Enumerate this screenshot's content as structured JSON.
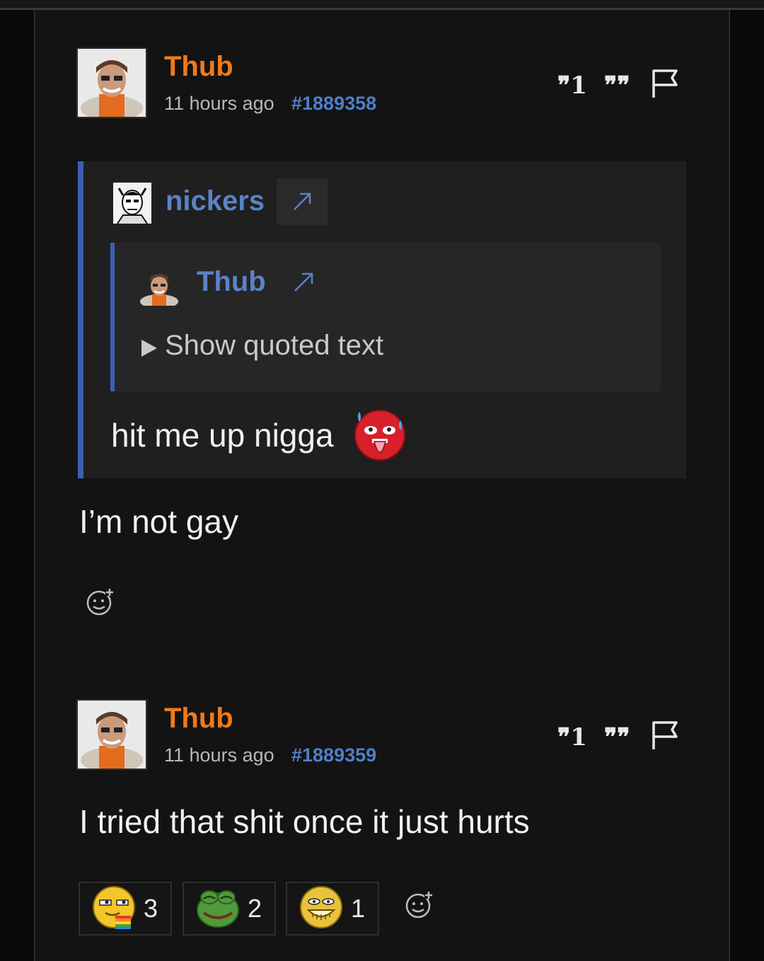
{
  "posts": [
    {
      "username": "Thub",
      "time": "11 hours ago",
      "post_id": "#1889358",
      "quote": {
        "author": "nickers",
        "nested_author": "Thub",
        "show_quoted_label": "Show quoted text",
        "text": "hit me up nigga"
      },
      "body": "I’m not gay"
    },
    {
      "username": "Thub",
      "time": "11 hours ago",
      "post_id": "#1889359",
      "body": "I tried that shit once it just hurts",
      "reactions": [
        {
          "icon": "gay-face-emoji-icon",
          "count": "3"
        },
        {
          "icon": "pepe-frog-emoji-icon",
          "count": "2"
        },
        {
          "icon": "troll-face-emoji-icon",
          "count": "1"
        }
      ]
    }
  ],
  "colors": {
    "username": "#f07a1a",
    "post_id": "#4f7fc8",
    "quote_border": "#3b5fb0",
    "quote_name": "#5b82c6"
  },
  "icons": [
    "reply-quote-icon",
    "multi-quote-icon",
    "report-flag-icon",
    "external-link-icon",
    "add-reaction-icon"
  ]
}
